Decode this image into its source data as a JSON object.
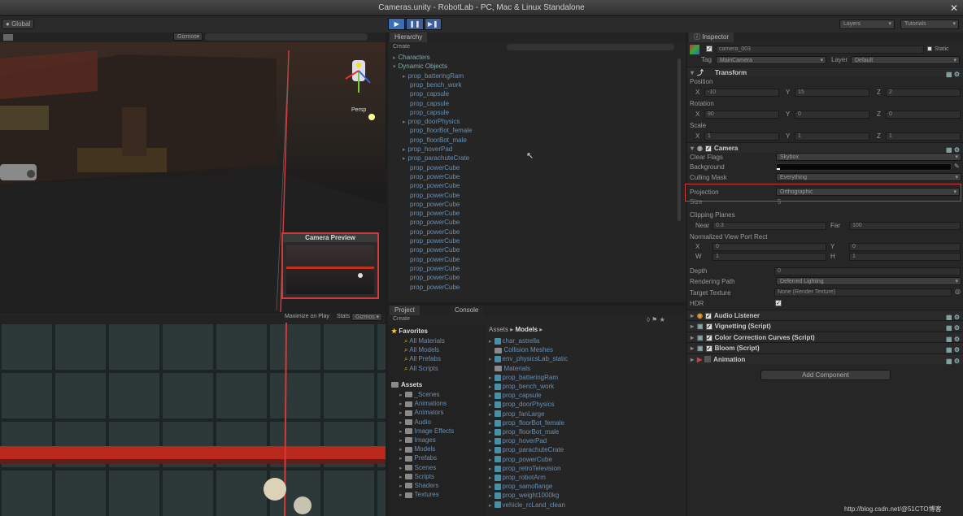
{
  "window": {
    "title": "Cameras.unity - RobotLab - PC, Mac & Linux Standalone"
  },
  "toolbar": {
    "global_label": "Global",
    "layers_label": "Layers",
    "tutorials_label": "Tutorials"
  },
  "scene": {
    "shading_mode": "Gizmos",
    "persp_label": "Persp",
    "camera_preview_title": "Camera Preview"
  },
  "game": {
    "maximize_label": "Maximize on Play",
    "stats_label": "Stats",
    "gizmos_label": "Gizmos"
  },
  "hierarchy": {
    "tab": "Hierarchy",
    "create_label": "Create",
    "items": [
      {
        "label": "Characters",
        "level": 0,
        "arrow": true
      },
      {
        "label": "Dynamic Objects",
        "level": 0,
        "arrow": true,
        "expanded": true
      },
      {
        "label": "prop_batteringRam",
        "level": 1,
        "arrow": true
      },
      {
        "label": "prop_bench_work",
        "level": 1,
        "arrow": false
      },
      {
        "label": "prop_capsule",
        "level": 1,
        "arrow": false
      },
      {
        "label": "prop_capsule",
        "level": 1,
        "arrow": false
      },
      {
        "label": "prop_capsule",
        "level": 1,
        "arrow": false
      },
      {
        "label": "prop_doorPhysics",
        "level": 1,
        "arrow": true
      },
      {
        "label": "prop_floorBot_female",
        "level": 1,
        "arrow": false
      },
      {
        "label": "prop_floorBot_male",
        "level": 1,
        "arrow": false
      },
      {
        "label": "prop_hoverPad",
        "level": 1,
        "arrow": true
      },
      {
        "label": "prop_parachuteCrate",
        "level": 1,
        "arrow": true
      },
      {
        "label": "prop_powerCube",
        "level": 1,
        "arrow": false
      },
      {
        "label": "prop_powerCube",
        "level": 1,
        "arrow": false
      },
      {
        "label": "prop_powerCube",
        "level": 1,
        "arrow": false
      },
      {
        "label": "prop_powerCube",
        "level": 1,
        "arrow": false
      },
      {
        "label": "prop_powerCube",
        "level": 1,
        "arrow": false
      },
      {
        "label": "prop_powerCube",
        "level": 1,
        "arrow": false
      },
      {
        "label": "prop_powerCube",
        "level": 1,
        "arrow": false
      },
      {
        "label": "prop_powerCube",
        "level": 1,
        "arrow": false
      },
      {
        "label": "prop_powerCube",
        "level": 1,
        "arrow": false
      },
      {
        "label": "prop_powerCube",
        "level": 1,
        "arrow": false
      },
      {
        "label": "prop_powerCube",
        "level": 1,
        "arrow": false
      },
      {
        "label": "prop_powerCube",
        "level": 1,
        "arrow": false
      },
      {
        "label": "prop_powerCube",
        "level": 1,
        "arrow": false
      },
      {
        "label": "prop_powerCube",
        "level": 1,
        "arrow": false
      }
    ]
  },
  "project": {
    "tab_project": "Project",
    "tab_console": "Console",
    "create_label": "Create",
    "favorites_label": "Favorites",
    "favorites": [
      "All Materials",
      "All Models",
      "All Prefabs",
      "All Scripts"
    ],
    "assets_label": "Assets",
    "folders": [
      "_Scenes",
      "Animations",
      "Animators",
      "Audio",
      "Image Effects",
      "Images",
      "Models",
      "Prefabs",
      "Scenes",
      "Scripts",
      "Shaders",
      "Textures"
    ],
    "breadcrumb_root": "Assets",
    "breadcrumb_current": "Models",
    "files": [
      "char_astrella",
      "Collision Meshes",
      "env_physicsLab_static",
      "Materials",
      "prop_batteringRam",
      "prop_bench_work",
      "prop_capsule",
      "prop_doorPhysics",
      "prop_fanLarge",
      "prop_floorBot_female",
      "prop_floorBot_male",
      "prop_hoverPad",
      "prop_parachuteCrate",
      "prop_powerCube",
      "prop_retroTelevision",
      "prop_robotArm",
      "prop_samoflange",
      "prop_weight1000kg",
      "vehicle_rcLand_clean"
    ]
  },
  "inspector": {
    "tab": "Inspector",
    "object_name": "camera_003",
    "static_label": "Static",
    "tag_label": "Tag",
    "tag_value": "MainCamera",
    "layer_label": "Layer",
    "layer_value": "Default",
    "transform": {
      "title": "Transform",
      "position_label": "Position",
      "rotation_label": "Rotation",
      "scale_label": "Scale",
      "position": {
        "x": "-10",
        "y": "15",
        "z": "2"
      },
      "rotation": {
        "x": "90",
        "y": "0",
        "z": "0"
      },
      "scale": {
        "x": "1",
        "y": "1",
        "z": "1"
      }
    },
    "camera": {
      "title": "Camera",
      "clear_flags_label": "Clear Flags",
      "clear_flags_value": "Skybox",
      "background_label": "Background",
      "culling_mask_label": "Culling Mask",
      "culling_mask_value": "Everything",
      "projection_label": "Projection",
      "projection_value": "Orthographic",
      "size_label": "Size",
      "size_value": "5",
      "clipping_label": "Clipping Planes",
      "near_label": "Near",
      "near_value": "0.3",
      "far_label": "Far",
      "far_value": "100",
      "viewport_label": "Normalized View Port Rect",
      "vp_x": "0",
      "vp_y": "0",
      "vp_w": "1",
      "vp_h": "1",
      "depth_label": "Depth",
      "depth_value": "0",
      "rendering_path_label": "Rendering Path",
      "rendering_path_value": "Deferred Lighting",
      "target_texture_label": "Target Texture",
      "target_texture_value": "None (Render Texture)",
      "hdr_label": "HDR"
    },
    "components": [
      "Audio Listener",
      "Vignetting (Script)",
      "Color Correction Curves (Script)",
      "Bloom (Script)",
      "Animation"
    ],
    "add_component_label": "Add Component"
  },
  "watermark": "http://blog.csdn.net/@51CTO博客",
  "colors": {
    "highlight": "#d23a3a",
    "accent_blue": "#4a7fc0"
  }
}
